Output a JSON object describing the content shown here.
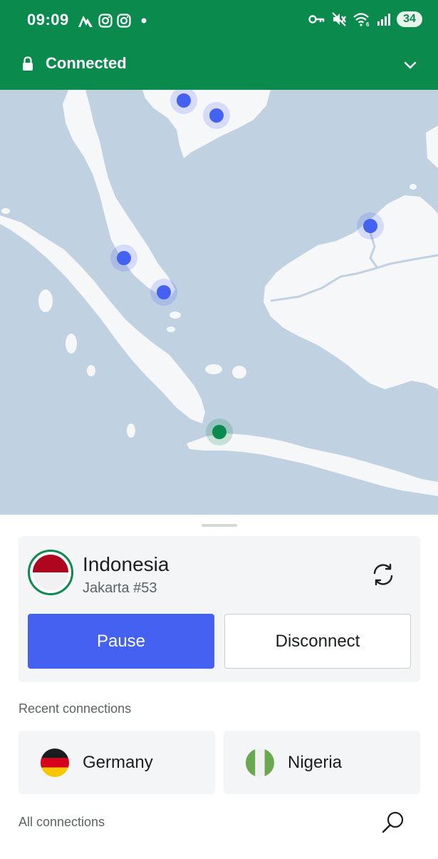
{
  "status_bar": {
    "time": "09:09",
    "battery": "34",
    "left_icons": [
      "nordvpn-icon",
      "instagram-icon",
      "instagram-icon",
      "dot-icon"
    ],
    "right_icons": [
      "vpn-key-icon",
      "mute-icon",
      "wifi-icon",
      "signal-icon"
    ]
  },
  "connection": {
    "status": "Connected",
    "accent_color": "#0b8a4e"
  },
  "current_server": {
    "country": "Indonesia",
    "server": "Jakarta #53",
    "pause_label": "Pause",
    "disconnect_label": "Disconnect",
    "pause_color": "#4461f2"
  },
  "recent": {
    "label": "Recent connections",
    "items": [
      {
        "country": "Germany"
      },
      {
        "country": "Nigeria"
      }
    ]
  },
  "all": {
    "label": "All connections"
  }
}
